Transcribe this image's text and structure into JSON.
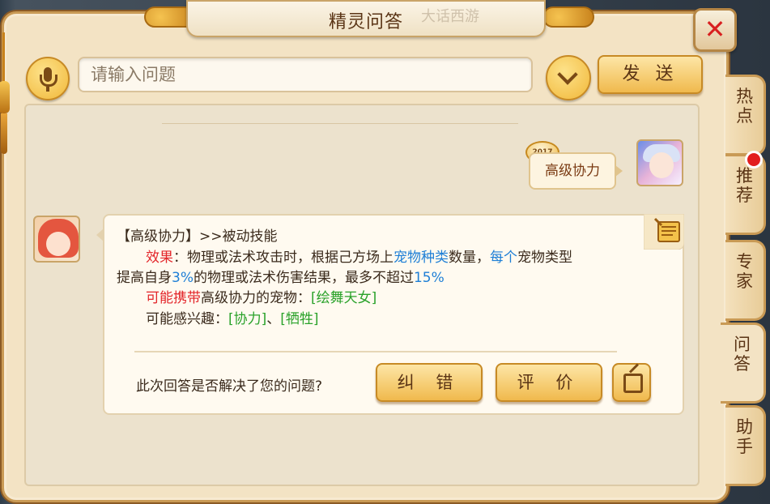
{
  "window": {
    "title": "精灵问答",
    "title_decoration": "大话西游"
  },
  "search": {
    "placeholder": "请输入问题",
    "send_label": "发 送"
  },
  "tabs": [
    {
      "label": "热点",
      "active": false,
      "badge": false
    },
    {
      "label": "推荐",
      "active": false,
      "badge": true
    },
    {
      "label": "专家",
      "active": false,
      "badge": false
    },
    {
      "label": "问答",
      "active": true,
      "badge": false
    },
    {
      "label": "助手",
      "active": false,
      "badge": false
    }
  ],
  "user_message": {
    "text": "高级协力",
    "badge": "2017"
  },
  "answer": {
    "line1": "【高级协力】>>被动技能",
    "line2": {
      "effect_label": "效果",
      "a": "：物理或法术攻击时，根据己方场上",
      "kw1": "宠物种类",
      "b": "数量，",
      "kw2": "每个",
      "c": "宠物类型"
    },
    "line3": {
      "a": "提高自身",
      "pct1": "3%",
      "b": "的物理或法术伤害结果，最多不超过",
      "pct2": "15%"
    },
    "line4": {
      "label": "可能携带",
      "a": "高级协力的宠物：",
      "pet": "[绘舞天女]"
    },
    "line5": {
      "a": "可能感兴趣：",
      "link1": "[协力]",
      "sep": "、",
      "link2": "[牺牲]"
    }
  },
  "feedback": {
    "question": "此次回答是否解决了您的问题?",
    "correct_label": "纠 错",
    "rate_label": "评 价"
  },
  "colors": {
    "red": "#e3262a",
    "blue": "#1e7fd6",
    "green": "#2aa22a",
    "brown": "#5a3415"
  }
}
